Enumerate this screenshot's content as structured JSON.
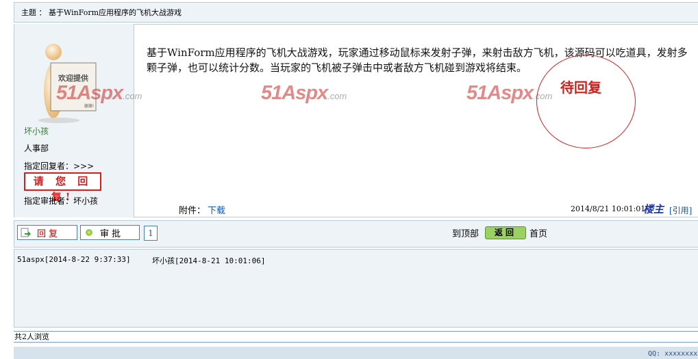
{
  "topic": {
    "label": "主题",
    "sep": "：",
    "title": "基于WinForm应用程序的飞机大战游戏"
  },
  "author": {
    "name": "坏小孩",
    "department": "人事部",
    "reply_to": "指定回复者：>>>",
    "please_reply": "请 您 回 复!",
    "approver": "指定审批者：坏小孩",
    "avatar_sign_top": "欢迎提供",
    "avatar_sign_bottom": "谢谢!"
  },
  "post": {
    "body": "基于WinForm应用程序的飞机大战游戏，玩家通过移动鼠标来发射子弹，来射击敌方飞机，该源码可以吃道具，发射多颗子弹，也可以统计分数。当玩家的飞机被子弹击中或者敌方飞机碰到游戏将结束。",
    "stamp": "待回复",
    "attachment_label": "附件：",
    "attachment_link": "下载",
    "time": "2014/8/21 10:01:01",
    "owner": "楼主",
    "quote": "[引用]"
  },
  "watermark": {
    "main": "51Aspx",
    "sub": ".com"
  },
  "toolbar": {
    "reply": "回复",
    "approve": "审批",
    "page": "1",
    "to_top": "到顶部",
    "back": "返回",
    "home": "首页"
  },
  "log": [
    "51aspx[2014-8-22 9:37:33]",
    "坏小孩[2014-8-21 10:01:06]"
  ],
  "viewers": "共2人浏览",
  "footer": {
    "qq": "QQ: xxxxxxxx"
  },
  "colors": {
    "accent_red": "#d01f1f",
    "link_blue": "#1556b3",
    "panel_bg": "#eef3f7"
  }
}
